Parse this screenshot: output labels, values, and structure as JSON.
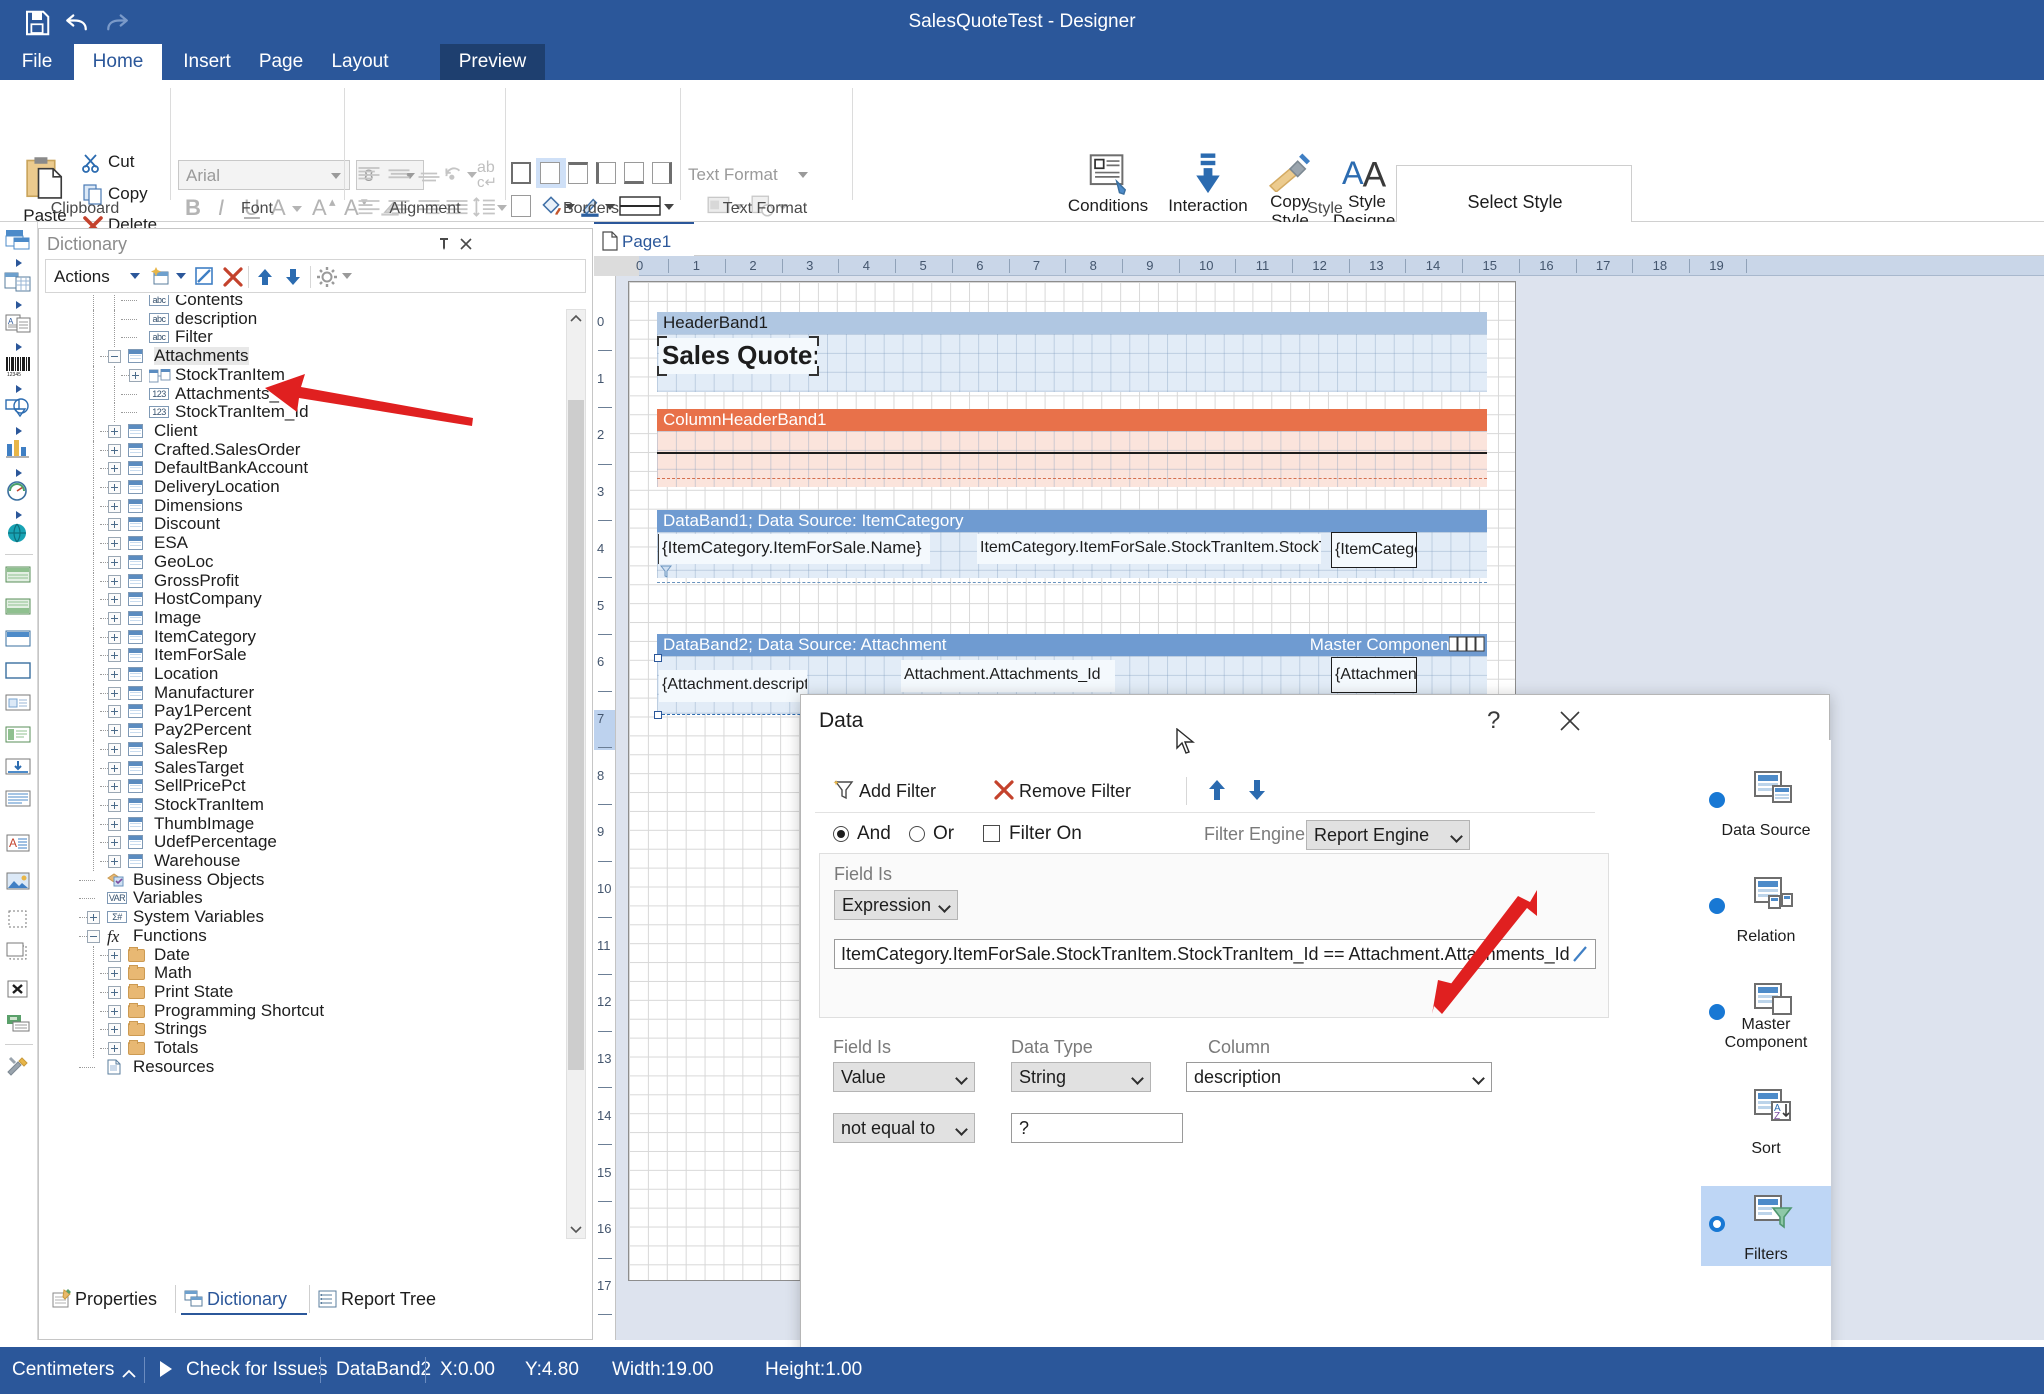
{
  "window": {
    "title": "SalesQuoteTest - Designer"
  },
  "quick_access": [
    {
      "name": "save-icon",
      "label": "Save"
    },
    {
      "name": "undo-icon",
      "label": "Undo"
    },
    {
      "name": "redo-icon",
      "label": "Redo"
    }
  ],
  "ribbon": {
    "tabs": [
      {
        "label": "File",
        "state": "normal"
      },
      {
        "label": "Home",
        "state": "active"
      },
      {
        "label": "Insert",
        "state": "normal"
      },
      {
        "label": "Page",
        "state": "normal"
      },
      {
        "label": "Layout",
        "state": "normal"
      },
      {
        "label": "Preview",
        "state": "pressed"
      }
    ],
    "groups": [
      {
        "label": "Clipboard"
      },
      {
        "label": "Font"
      },
      {
        "label": "Alignment"
      },
      {
        "label": "Borders"
      },
      {
        "label": "Text Format"
      },
      {
        "label": "Style"
      }
    ],
    "clipboard": {
      "paste": "Paste",
      "cut": "Cut",
      "copy": "Copy",
      "delete": "Delete"
    },
    "font": {
      "family": "Arial",
      "size": "8",
      "bold": "B",
      "italic": "I",
      "underline": "U",
      "font_color": "A",
      "grow_font": "A",
      "shrink_font": "A",
      "clear_format": "clear-formatting-icon"
    },
    "text_format": {
      "label": "Text Format"
    },
    "style": {
      "conditions": "Conditions",
      "interaction": "Interaction",
      "copy_style": "Copy Style",
      "style_designer": "Style Designer",
      "select_style": "Select Style"
    }
  },
  "left_toolbar": [
    "page-icon",
    "table-icon",
    "text-icon",
    "barcode-icon",
    "shape-icon",
    "chart-icon",
    "gauge-icon",
    "map-icon",
    "header-band-icon",
    "footer-band-icon",
    "databand-icon",
    "panel-icon",
    "group-header-icon",
    "hierarchical-band-icon",
    "child-band-icon",
    "text-band-icon",
    "rich-text-icon",
    "image-icon",
    "dashed-panel-icon",
    "clone-panel-icon",
    "cross-icon",
    "resource-icon",
    "tools-icon"
  ],
  "dictionary": {
    "title": "Dictionary",
    "toolbar": {
      "actions": "Actions",
      "new_item": "new-item-icon",
      "edit": "edit-icon",
      "delete": "delete-icon",
      "move_up": "move-up-icon",
      "move_down": "move-down-icon",
      "settings": "gear-icon"
    },
    "tree": [
      {
        "label": "Contents",
        "indent": 4,
        "icon": "abc",
        "expander": "none"
      },
      {
        "label": "description",
        "indent": 4,
        "icon": "abc",
        "expander": "none"
      },
      {
        "label": "Filter",
        "indent": 4,
        "icon": "abc",
        "expander": "none"
      },
      {
        "label": "Attachments",
        "indent": 3,
        "icon": "table",
        "expander": "minus",
        "selected": true
      },
      {
        "label": "StockTranItem",
        "indent": 4,
        "icon": "relation",
        "expander": "plus"
      },
      {
        "label": "Attachments_Id",
        "indent": 4,
        "icon": "num",
        "expander": "none"
      },
      {
        "label": "StockTranItem_Id",
        "indent": 4,
        "icon": "num",
        "expander": "none"
      },
      {
        "label": "Client",
        "indent": 3,
        "icon": "table",
        "expander": "plus"
      },
      {
        "label": "Crafted.SalesOrder",
        "indent": 3,
        "icon": "table",
        "expander": "plus"
      },
      {
        "label": "DefaultBankAccount",
        "indent": 3,
        "icon": "table",
        "expander": "plus"
      },
      {
        "label": "DeliveryLocation",
        "indent": 3,
        "icon": "table",
        "expander": "plus"
      },
      {
        "label": "Dimensions",
        "indent": 3,
        "icon": "table",
        "expander": "plus"
      },
      {
        "label": "Discount",
        "indent": 3,
        "icon": "table",
        "expander": "plus"
      },
      {
        "label": "ESA",
        "indent": 3,
        "icon": "table",
        "expander": "plus"
      },
      {
        "label": "GeoLoc",
        "indent": 3,
        "icon": "table",
        "expander": "plus"
      },
      {
        "label": "GrossProfit",
        "indent": 3,
        "icon": "table",
        "expander": "plus"
      },
      {
        "label": "HostCompany",
        "indent": 3,
        "icon": "table",
        "expander": "plus"
      },
      {
        "label": "Image",
        "indent": 3,
        "icon": "table",
        "expander": "plus"
      },
      {
        "label": "ItemCategory",
        "indent": 3,
        "icon": "table",
        "expander": "plus"
      },
      {
        "label": "ItemForSale",
        "indent": 3,
        "icon": "table",
        "expander": "plus"
      },
      {
        "label": "Location",
        "indent": 3,
        "icon": "table",
        "expander": "plus"
      },
      {
        "label": "Manufacturer",
        "indent": 3,
        "icon": "table",
        "expander": "plus"
      },
      {
        "label": "Pay1Percent",
        "indent": 3,
        "icon": "table",
        "expander": "plus"
      },
      {
        "label": "Pay2Percent",
        "indent": 3,
        "icon": "table",
        "expander": "plus"
      },
      {
        "label": "SalesRep",
        "indent": 3,
        "icon": "table",
        "expander": "plus"
      },
      {
        "label": "SalesTarget",
        "indent": 3,
        "icon": "table",
        "expander": "plus"
      },
      {
        "label": "SellPricePct",
        "indent": 3,
        "icon": "table",
        "expander": "plus"
      },
      {
        "label": "StockTranItem",
        "indent": 3,
        "icon": "table",
        "expander": "plus"
      },
      {
        "label": "ThumbImage",
        "indent": 3,
        "icon": "table",
        "expander": "plus"
      },
      {
        "label": "UdefPercentage",
        "indent": 3,
        "icon": "table",
        "expander": "plus"
      },
      {
        "label": "Warehouse",
        "indent": 3,
        "icon": "table",
        "expander": "plus"
      },
      {
        "label": "Business Objects",
        "indent": 2,
        "icon": "bizobj",
        "expander": "none"
      },
      {
        "label": "Variables",
        "indent": 2,
        "icon": "var",
        "expander": "none"
      },
      {
        "label": "System Variables",
        "indent": 2,
        "icon": "sysvar",
        "expander": "plus"
      },
      {
        "label": "Functions",
        "indent": 2,
        "icon": "fx",
        "expander": "minus"
      },
      {
        "label": "Date",
        "indent": 3,
        "icon": "folder",
        "expander": "plus"
      },
      {
        "label": "Math",
        "indent": 3,
        "icon": "folder",
        "expander": "plus"
      },
      {
        "label": "Print State",
        "indent": 3,
        "icon": "folder",
        "expander": "plus"
      },
      {
        "label": "Programming Shortcut",
        "indent": 3,
        "icon": "folder",
        "expander": "plus"
      },
      {
        "label": "Strings",
        "indent": 3,
        "icon": "folder",
        "expander": "plus"
      },
      {
        "label": "Totals",
        "indent": 3,
        "icon": "folder",
        "expander": "plus"
      },
      {
        "label": "Resources",
        "indent": 2,
        "icon": "resource",
        "expander": "none"
      }
    ],
    "bottom_tabs": [
      {
        "label": "Properties",
        "active": false,
        "icon": "properties-icon"
      },
      {
        "label": "Dictionary",
        "active": true,
        "icon": "dictionary-icon"
      },
      {
        "label": "Report Tree",
        "active": false,
        "icon": "report-tree-icon"
      }
    ]
  },
  "workspace": {
    "page_tab": "Page1",
    "h_ruler_ticks": [
      "0",
      "1",
      "2",
      "3",
      "4",
      "5",
      "6",
      "7",
      "8",
      "9",
      "10",
      "11",
      "12",
      "13",
      "14",
      "15",
      "16",
      "17",
      "18",
      "19"
    ],
    "v_ruler_ticks": [
      "0",
      "1",
      "2",
      "3",
      "4",
      "5",
      "6",
      "7",
      "8",
      "9",
      "10",
      "11",
      "12",
      "13",
      "14",
      "15",
      "16",
      "17"
    ],
    "v_ruler_highlight": "5",
    "bands": [
      {
        "name": "HeaderBand1",
        "kind": "header"
      },
      {
        "name": "ColumnHeaderBand1",
        "kind": "columnheader"
      },
      {
        "name": "DataBand1; Data Source: ItemCategory",
        "kind": "data"
      },
      {
        "name": "DataBand2; Data Source: Attachment",
        "kind": "data",
        "right_label": "Master Component:"
      }
    ],
    "components": [
      {
        "text": "Sales Quote:",
        "band": "header"
      },
      {
        "text": "{ItemCategory.ItemForSale.Name}",
        "band": "data1"
      },
      {
        "text": "ItemCategory.ItemForSale.StockTranItem.StockTranItem_Id",
        "band": "data1"
      },
      {
        "text": "{ItemCategory",
        "band": "data1"
      },
      {
        "text": "{Attachment.description}",
        "band": "data2"
      },
      {
        "text": "Attachment.Attachments_Id",
        "band": "data2"
      },
      {
        "text": "{Attachment.A",
        "band": "data2"
      }
    ]
  },
  "dialog": {
    "title": "Data",
    "help_icon": "?",
    "close_icon": "close-icon",
    "toolbar": {
      "add_filter": "Add Filter",
      "remove_filter": "Remove Filter",
      "move_up": "move-up-icon",
      "move_down": "move-down-icon"
    },
    "logic": {
      "and_label": "And",
      "and_checked": true,
      "or_label": "Or",
      "or_checked": false,
      "filter_on_label": "Filter On",
      "filter_on_checked": false,
      "filter_engine_label": "Filter Engine",
      "filter_engine_value": "Report Engine"
    },
    "expression_row": {
      "field_is_label": "Field Is",
      "field_is_value": "Expression",
      "expression": "ItemCategory.ItemForSale.StockTranItem.StockTranItem_Id == Attachment.Attachments_Id",
      "edit_icon": "pencil-icon"
    },
    "value_row": {
      "field_is_label": "Field Is",
      "field_is_value": "Value",
      "data_type_label": "Data Type",
      "data_type_value": "String",
      "column_label": "Column",
      "column_value": "description",
      "condition_value": "not equal to",
      "compare_value": "?"
    },
    "modes": [
      {
        "label": "Data Source",
        "selected": false,
        "icon": "data-source-icon"
      },
      {
        "label": "Relation",
        "selected": false,
        "icon": "relation-icon"
      },
      {
        "label": "Master Component",
        "selected": false,
        "icon": "master-component-icon"
      },
      {
        "label": "Sort",
        "selected": false,
        "icon": "sort-icon"
      },
      {
        "label": "Filters",
        "selected": true,
        "icon": "filters-icon"
      }
    ]
  },
  "statusbar": {
    "units": "Centimeters",
    "units_arrow": "chevron-up-icon",
    "check_for_issues": "Check for Issues",
    "selected_object": "DataBand2",
    "x": "X:0.00",
    "y": "Y:4.80",
    "width": "Width:19.00",
    "height": "Height:1.00"
  },
  "colors": {
    "brand_blue": "#2b579a",
    "band_blue": "#6f9bd1",
    "band_orange": "#e8714a",
    "accent_dot": "#1878d4",
    "annotation_red": "#e02020"
  }
}
